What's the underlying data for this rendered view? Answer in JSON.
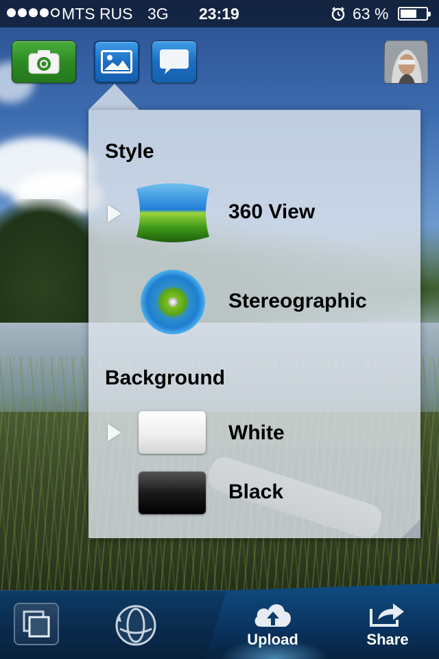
{
  "status_bar": {
    "carrier": "MTS RUS",
    "network": "3G",
    "time": "23:19",
    "battery_percent": "63 %",
    "battery_level": 0.63,
    "signal_bars_filled": 4,
    "signal_bars_total": 5
  },
  "top_bar": {
    "camera_icon": "camera-icon",
    "gallery_icon": "image-icon",
    "comment_icon": "speech-bubble-icon",
    "avatar_icon": "user-avatar"
  },
  "popover": {
    "style_section": {
      "title": "Style",
      "options": [
        {
          "label": "360 View",
          "icon": "panorama-360-icon",
          "selected": true
        },
        {
          "label": "Stereographic",
          "icon": "stereographic-icon",
          "selected": false
        }
      ]
    },
    "background_section": {
      "title": "Background",
      "options": [
        {
          "label": "White",
          "swatch": "#ffffff",
          "selected": true
        },
        {
          "label": "Black",
          "swatch": "#000000",
          "selected": false
        }
      ]
    }
  },
  "toolbar": {
    "layers_icon": "layers-icon",
    "rotate_icon": "rotate-3d-icon",
    "upload_label": "Upload",
    "upload_icon": "cloud-upload-icon",
    "share_label": "Share",
    "share_icon": "share-icon"
  },
  "colors": {
    "green_button": "#2d8a23",
    "blue_button": "#1b6fc4",
    "toolbar": "#0a2c4f"
  }
}
